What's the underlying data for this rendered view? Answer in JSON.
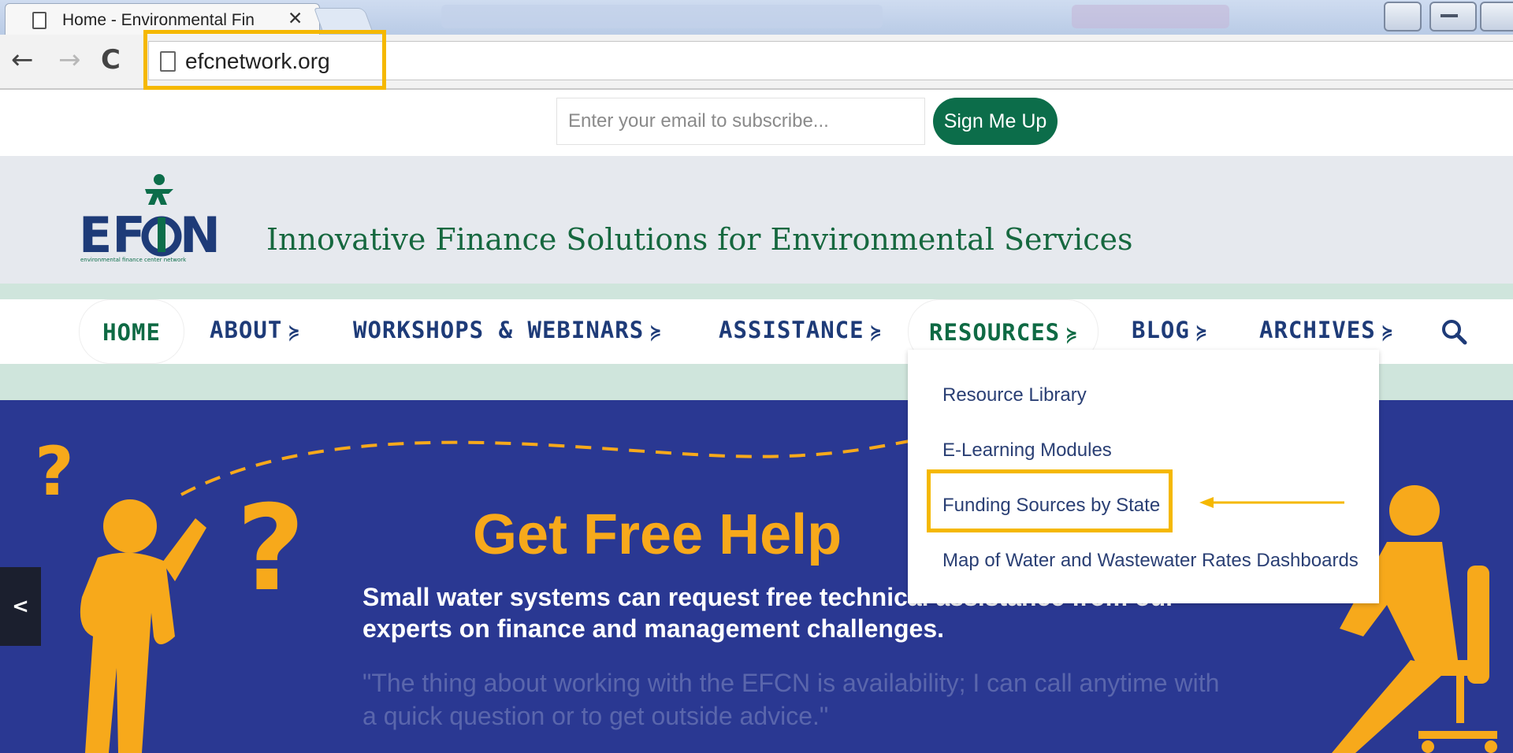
{
  "browser": {
    "tab_title": "Home - Environmental Fin",
    "url": "efcnetwork.org",
    "close_glyph": "✕",
    "back_glyph": "←",
    "forward_glyph": "→",
    "reload_glyph": "C"
  },
  "subscribe": {
    "placeholder": "Enter your email to subscribe...",
    "button_label": "Sign Me Up"
  },
  "header": {
    "logo_text": "EFCN",
    "logo_subtext": "environmental finance center network",
    "tagline": "Innovative Finance Solutions for Environmental Services"
  },
  "nav": {
    "items": [
      {
        "label": "HOME"
      },
      {
        "label": "ABOUT"
      },
      {
        "label": "WORKSHOPS & WEBINARS"
      },
      {
        "label": "ASSISTANCE"
      },
      {
        "label": "RESOURCES"
      },
      {
        "label": "BLOG"
      },
      {
        "label": "ARCHIVES"
      }
    ],
    "chevron": "≽",
    "active": "RESOURCES"
  },
  "dropdown": {
    "items": [
      {
        "label": "Resource Library"
      },
      {
        "label": "E-Learning Modules"
      },
      {
        "label": "Funding Sources by State"
      },
      {
        "label": "Map of Water and Wastewater Rates Dashboards"
      }
    ],
    "highlighted": "Funding Sources by State"
  },
  "hero": {
    "title": "Get Free Help",
    "subtitle": "Small water systems can request free technical assistance from our experts on finance and management challenges.",
    "quote": "\"The thing about working with the EFCN is availability; I can call anytime with a quick question or to get outside advice.\"",
    "prev_glyph": "<"
  },
  "colors": {
    "brand_green": "#0c6d4a",
    "nav_blue": "#1e3b78",
    "hero_bg": "#2a3892",
    "hero_accent": "#f7a91b",
    "annotation": "#f5b800"
  }
}
